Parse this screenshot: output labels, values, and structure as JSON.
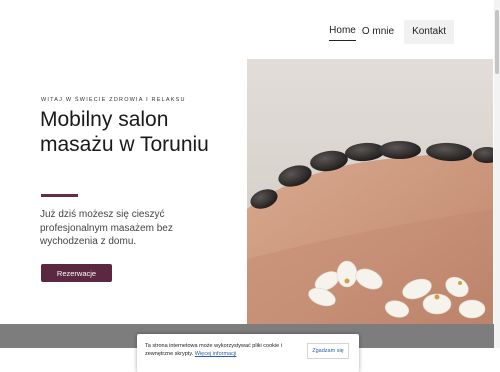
{
  "nav": {
    "home": "Home",
    "about": "O mnie",
    "contact": "Kontakt"
  },
  "hero": {
    "eyebrow": "WITAJ W ŚWIECIE ZDROWIA I RELAKSU",
    "title": "Mobilny salon masażu w Toruniu",
    "lead": "Już dziś możesz się cieszyć profesjonalnym masażem bez wychodzenia z domu.",
    "button": "Rezerwacje"
  },
  "cookie": {
    "text": "Ta strona internetowa może wykorzystywać pliki cookie i zewnętrzne skrypty.",
    "link": "Więcej informacji",
    "button": "Zgadzam się"
  },
  "colors": {
    "accent": "#5b2741",
    "rule": "#6b2a44",
    "strip": "#7d7d7d"
  }
}
